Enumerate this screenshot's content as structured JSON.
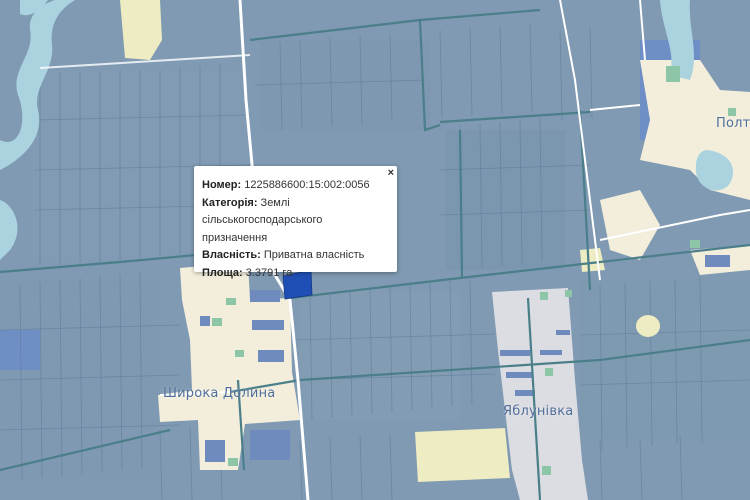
{
  "map": {
    "colors": {
      "parcel": "#7f9ab2",
      "road": "#ffffff",
      "field_edge": "#4a7f8a",
      "settlement": "#f3eedc",
      "settlement_grey": "#dcdde2",
      "water": "#aad3df",
      "selected_parcel": "#1f4fb5",
      "green_area": "#8dc6a6",
      "yellow_field": "#eeecc2"
    },
    "place_labels": {
      "shyroka": "Широка Долина",
      "yablunivka": "Яблунівка",
      "polt": "Полт"
    }
  },
  "popup": {
    "close_symbol": "×",
    "rows": [
      {
        "label": "Номер:",
        "value": "1225886600:15:002:0056"
      },
      {
        "label": "Категорія:",
        "value": "Землі сільськогосподарського призначення"
      },
      {
        "label": "Власність:",
        "value": "Приватна власність"
      },
      {
        "label": "Площа:",
        "value": "3.3791 га"
      }
    ]
  }
}
